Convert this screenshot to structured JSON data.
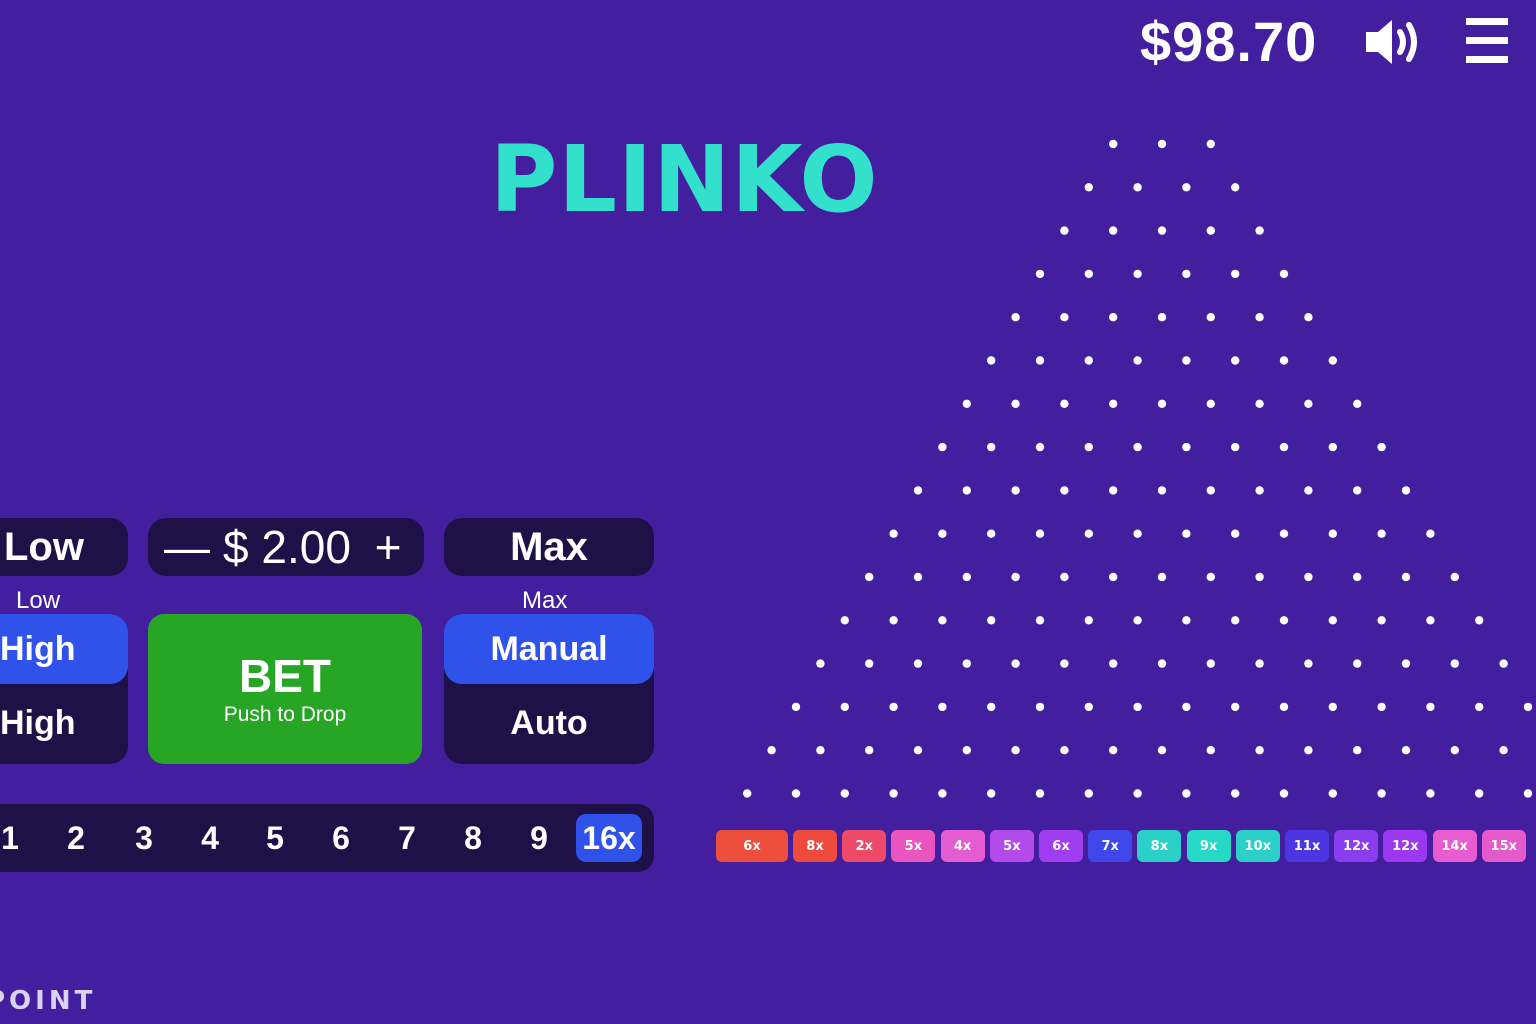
{
  "header": {
    "balance": "$98.70",
    "sound_icon": "speaker-volume-icon",
    "menu_icon": "hamburger-menu-icon"
  },
  "logo": {
    "text": "PLINKO",
    "color": "#33e0cb"
  },
  "controls": {
    "risk_current": "Low",
    "risk_label": "Low",
    "risk_options": [
      "High",
      "High"
    ],
    "risk_active_index": 0,
    "bet_decrease": "—",
    "bet_amount": "$ 2.00",
    "bet_increase": "+",
    "max_button": "Max",
    "max_label": "Max",
    "bet_button": {
      "label": "BET",
      "sublabel": "Push to Drop"
    },
    "mode_options": [
      "Manual",
      "Auto"
    ],
    "mode_active_index": 0,
    "rows_options": [
      "1",
      "2",
      "3",
      "4",
      "5",
      "6",
      "7",
      "8",
      "9",
      "16x"
    ],
    "rows_active_index": 9
  },
  "board": {
    "peg_rows": 16,
    "pegs_in_first_row": 3,
    "multipliers": [
      {
        "label": "6x",
        "color": "#ee4e3c"
      },
      {
        "label": "8x",
        "color": "#ef4a3e"
      },
      {
        "label": "2x",
        "color": "#ee4a67"
      },
      {
        "label": "5x",
        "color": "#ea55bf"
      },
      {
        "label": "4x",
        "color": "#e45cd2"
      },
      {
        "label": "5x",
        "color": "#b24bea"
      },
      {
        "label": "6x",
        "color": "#a03df0"
      },
      {
        "label": "7x",
        "color": "#3f47ea"
      },
      {
        "label": "8x",
        "color": "#2bd1c9"
      },
      {
        "label": "9x",
        "color": "#26d8c5"
      },
      {
        "label": "10x",
        "color": "#2cd0c8"
      },
      {
        "label": "11x",
        "color": "#4c35e3"
      },
      {
        "label": "12x",
        "color": "#8a3cef"
      },
      {
        "label": "12x",
        "color": "#9c38f2"
      },
      {
        "label": "14x",
        "color": "#e85cd1"
      },
      {
        "label": "15x",
        "color": "#e55acb"
      }
    ]
  },
  "footer": {
    "brand": "POINT"
  },
  "colors": {
    "background": "#431f9f",
    "panel": "#1e1147",
    "accent_blue": "#2f52ea",
    "bet_green": "#27a524",
    "peg": "#ffffff"
  }
}
